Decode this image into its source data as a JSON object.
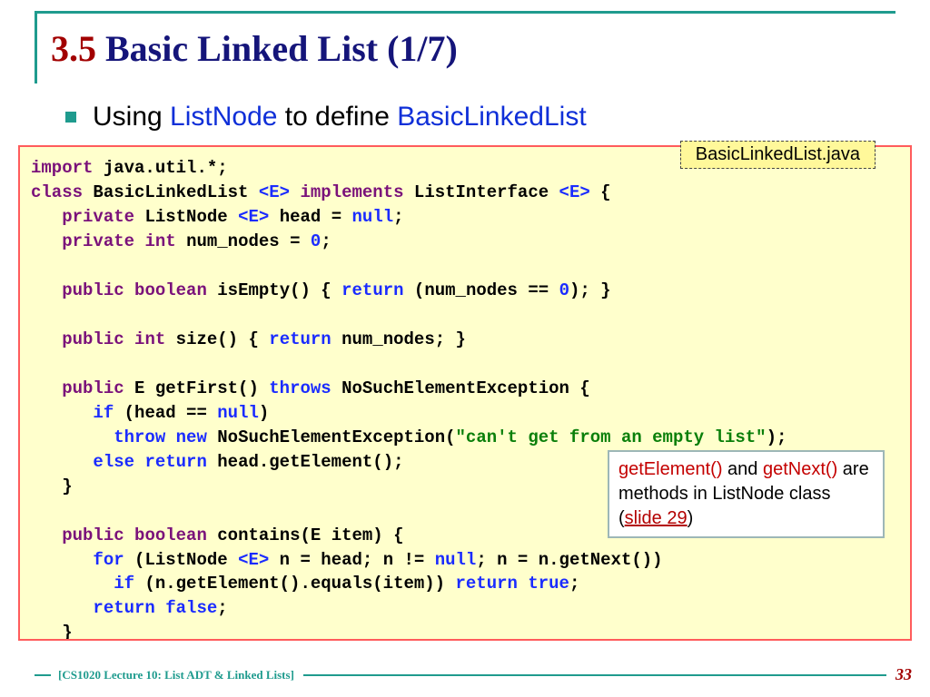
{
  "title": {
    "section": "3.5",
    "text": "Basic Linked List (1/7)"
  },
  "bullet": {
    "pre": "Using ",
    "hl1": "ListNode",
    "mid": " to define ",
    "hl2": "BasicLinkedList"
  },
  "file_label": "BasicLinkedList.java",
  "note": {
    "m1": "getElement()",
    "m2": "getNext()",
    "tail1": " and ",
    "tail2": " are methods in ListNode class (",
    "link": "slide 29",
    "tail3": ")"
  },
  "code": {
    "l1": {
      "a": "import",
      "b": " java.util.*;"
    },
    "l2": {
      "a": "class",
      "b": " BasicLinkedList ",
      "c": "<E>",
      "d": " ",
      "e": "implements",
      "f": " ListInterface ",
      "g": "<E>",
      "h": " {"
    },
    "l3": {
      "i": "   ",
      "a": "private",
      "b": " ListNode ",
      "c": "<E>",
      "d": " head = ",
      "e": "null",
      "f": ";"
    },
    "l4": {
      "i": "   ",
      "a": "private",
      "b": " ",
      "c": "int",
      "d": " num_nodes = ",
      "e": "0",
      "f": ";"
    },
    "l6": {
      "i": "   ",
      "a": "public",
      "b": " ",
      "c": "boolean",
      "d": " isEmpty() { ",
      "e": "return",
      "f": " (num_nodes == ",
      "g": "0",
      "h": "); }"
    },
    "l8": {
      "i": "   ",
      "a": "public",
      "b": " ",
      "c": "int",
      "d": " size() { ",
      "e": "return",
      "f": " num_nodes; }"
    },
    "l10": {
      "i": "   ",
      "a": "public",
      "b": " E getFirst() ",
      "c": "throws",
      "d": " NoSuchElementException {"
    },
    "l11": {
      "i": "      ",
      "a": "if",
      "b": " (head == ",
      "c": "null",
      "d": ")"
    },
    "l12": {
      "i": "        ",
      "a": "throw",
      "b": " ",
      "c": "new",
      "d": " NoSuchElementException(",
      "e": "\"can't get from an empty list\"",
      "f": ");"
    },
    "l13": {
      "i": "      ",
      "a": "else",
      "b": " ",
      "c": "return",
      "d": " head.getElement();"
    },
    "l14": {
      "i": "   ",
      "a": "}"
    },
    "l16": {
      "i": "   ",
      "a": "public",
      "b": " ",
      "c": "boolean",
      "d": " contains(E item) {"
    },
    "l17": {
      "i": "      ",
      "a": "for",
      "b": " (ListNode ",
      "c": "<E>",
      "d": " n = head; n != ",
      "e": "null",
      "f": "; n = n.getNext())"
    },
    "l18": {
      "i": "        ",
      "a": "if",
      "b": " (n.getElement().equals(item)) ",
      "c": "return",
      "d": " ",
      "e": "true",
      "f": ";"
    },
    "l19": {
      "i": "      ",
      "a": "return",
      "b": " ",
      "c": "false",
      "d": ";"
    },
    "l20": {
      "i": "   ",
      "a": "}"
    }
  },
  "footer": {
    "text": "[CS1020 Lecture 10: List ADT & Linked Lists]",
    "page": "33"
  }
}
